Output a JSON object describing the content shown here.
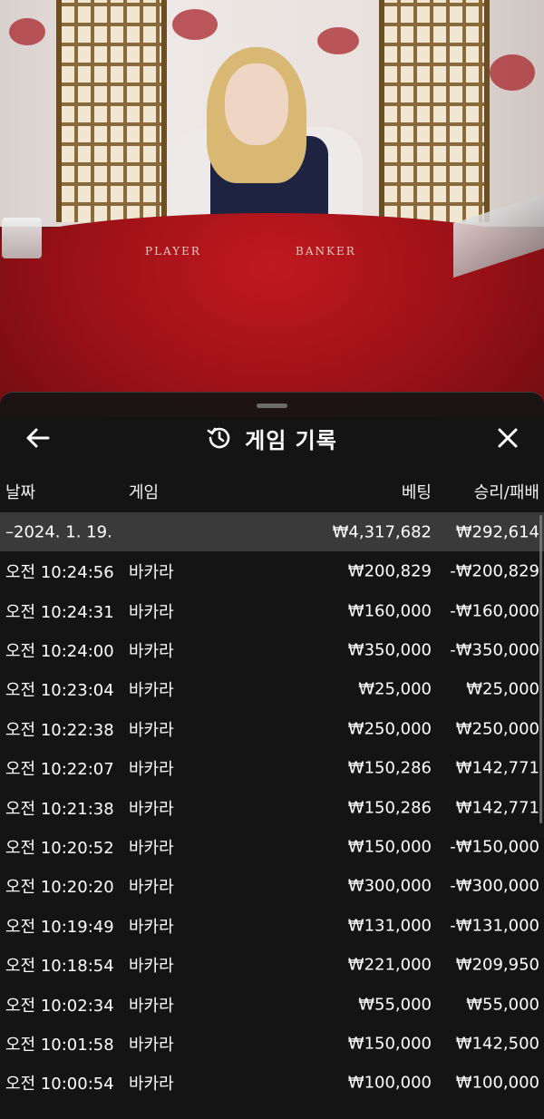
{
  "video": {
    "labels": [
      "PLAYER",
      "BANKER"
    ]
  },
  "sheet": {
    "title": "게임 기록",
    "icons": {
      "back": "arrow-left-icon",
      "history": "history-icon",
      "close": "close-icon"
    },
    "columns": {
      "date": "날짜",
      "game": "게임",
      "bet": "베팅",
      "result": "승리/패배"
    },
    "summary": {
      "date": "–2024. 1. 19.",
      "bet": "₩4,317,682",
      "result": "₩292,614"
    },
    "rows": [
      {
        "time": "오전 10:24:56",
        "game": "바카라",
        "bet": "₩200,829",
        "result": "-₩200,829"
      },
      {
        "time": "오전 10:24:31",
        "game": "바카라",
        "bet": "₩160,000",
        "result": "-₩160,000"
      },
      {
        "time": "오전 10:24:00",
        "game": "바카라",
        "bet": "₩350,000",
        "result": "-₩350,000"
      },
      {
        "time": "오전 10:23:04",
        "game": "바카라",
        "bet": "₩25,000",
        "result": "₩25,000"
      },
      {
        "time": "오전 10:22:38",
        "game": "바카라",
        "bet": "₩250,000",
        "result": "₩250,000"
      },
      {
        "time": "오전 10:22:07",
        "game": "바카라",
        "bet": "₩150,286",
        "result": "₩142,771"
      },
      {
        "time": "오전 10:21:38",
        "game": "바카라",
        "bet": "₩150,286",
        "result": "₩142,771"
      },
      {
        "time": "오전 10:20:52",
        "game": "바카라",
        "bet": "₩150,000",
        "result": "-₩150,000"
      },
      {
        "time": "오전 10:20:20",
        "game": "바카라",
        "bet": "₩300,000",
        "result": "-₩300,000"
      },
      {
        "time": "오전 10:19:49",
        "game": "바카라",
        "bet": "₩131,000",
        "result": "-₩131,000"
      },
      {
        "time": "오전 10:18:54",
        "game": "바카라",
        "bet": "₩221,000",
        "result": "₩209,950"
      },
      {
        "time": "오전 10:02:34",
        "game": "바카라",
        "bet": "₩55,000",
        "result": "₩55,000"
      },
      {
        "time": "오전 10:01:58",
        "game": "바카라",
        "bet": "₩150,000",
        "result": "₩142,500"
      },
      {
        "time": "오전 10:00:54",
        "game": "바카라",
        "bet": "₩100,000",
        "result": "₩100,000"
      }
    ]
  }
}
